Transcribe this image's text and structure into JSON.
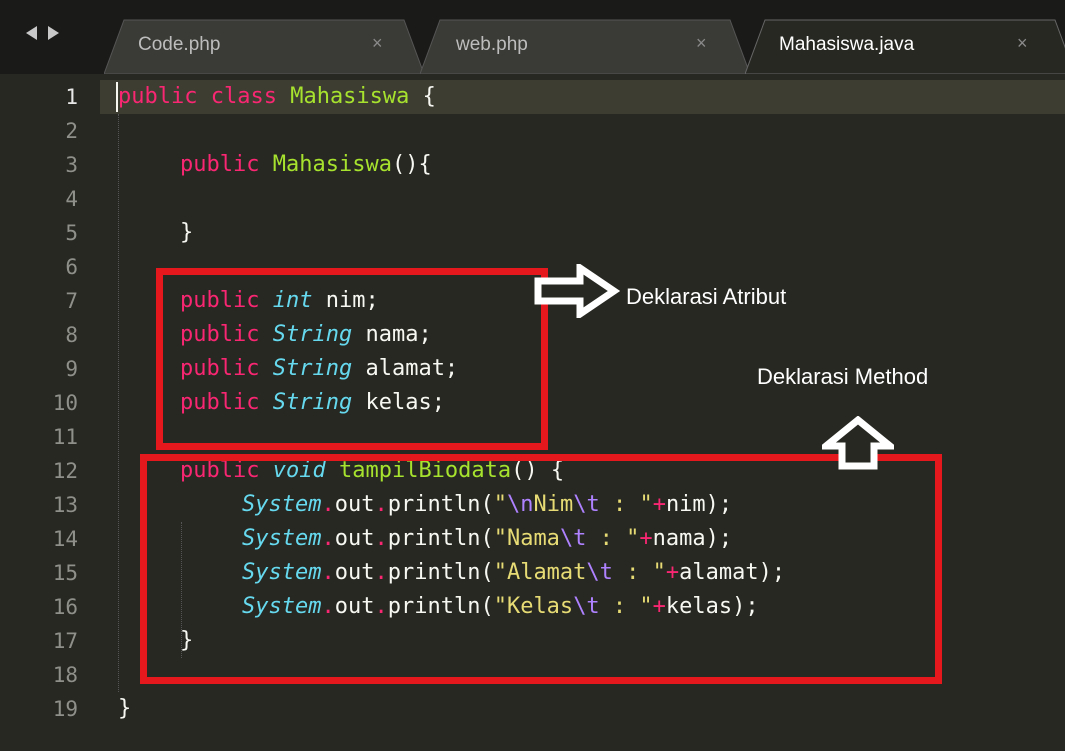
{
  "tabs": [
    {
      "label": "Code.php",
      "close": "×",
      "active": false
    },
    {
      "label": "web.php",
      "close": "×",
      "active": false
    },
    {
      "label": "Mahasiswa.java",
      "close": "×",
      "active": true
    }
  ],
  "line_numbers": [
    "1",
    "2",
    "3",
    "4",
    "5",
    "6",
    "7",
    "8",
    "9",
    "10",
    "11",
    "12",
    "13",
    "14",
    "15",
    "16",
    "17",
    "18",
    "19"
  ],
  "code": {
    "l1": {
      "kw": "public class",
      "cls": "Mahasiswa",
      "rest": " {"
    },
    "l3": {
      "kw": "public",
      "fn": "Mahasiswa",
      "rest": "(){"
    },
    "l5": {
      "rest": "}"
    },
    "l7": {
      "kw": "public",
      "typ": "int",
      "rest": " nim;"
    },
    "l8": {
      "kw": "public",
      "typ": "String",
      "rest": " nama;"
    },
    "l9": {
      "kw": "public",
      "typ": "String",
      "rest": " alamat;"
    },
    "l10": {
      "kw": "public",
      "typ": "String",
      "rest": " kelas;"
    },
    "l12": {
      "kw": "public",
      "typ": "void",
      "fn": "tampilBiodata",
      "rest": "() {"
    },
    "l13": {
      "typ": "System",
      "dot": ".",
      "mid": "out",
      "dot2": ".",
      "call": "println(",
      "q1": "\"",
      "e1": "\\n",
      "s1": "Nim",
      "e2": "\\t",
      "s2": " : \"",
      "plus": "+",
      "end": "nim);"
    },
    "l14": {
      "typ": "System",
      "dot": ".",
      "mid": "out",
      "dot2": ".",
      "call": "println(",
      "s1": "\"Nama",
      "e2": "\\t",
      "s2": " : \"",
      "plus": "+",
      "end": "nama);"
    },
    "l15": {
      "typ": "System",
      "dot": ".",
      "mid": "out",
      "dot2": ".",
      "call": "println(",
      "s1": "\"Alamat",
      "e2": "\\t",
      "s2": " : \"",
      "plus": "+",
      "end": "alamat);"
    },
    "l16": {
      "typ": "System",
      "dot": ".",
      "mid": "out",
      "dot2": ".",
      "call": "println(",
      "s1": "\"Kelas",
      "e2": "\\t",
      "s2": " : \"",
      "plus": "+",
      "end": "kelas);"
    },
    "l17": {
      "rest": "}"
    },
    "l19": {
      "rest": "}"
    }
  },
  "annotations": {
    "atribut": "Deklarasi Atribut",
    "method": "Deklarasi Method"
  },
  "colors": {
    "background": "#272822",
    "keyword": "#f92672",
    "type": "#66d9ef",
    "class": "#a6e22e",
    "box": "#e5181e"
  }
}
